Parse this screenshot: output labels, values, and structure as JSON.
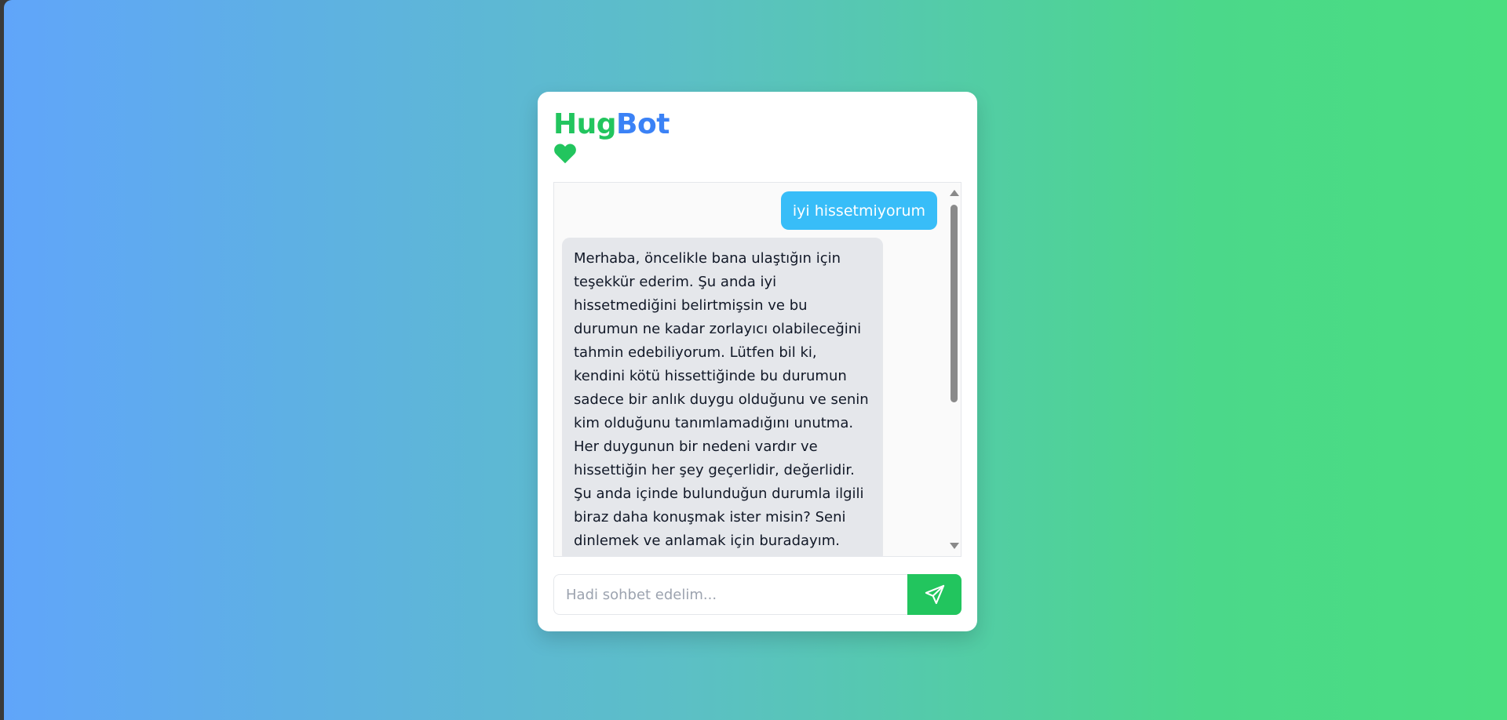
{
  "app": {
    "logo_part1": "Hug",
    "logo_part2": "Bot",
    "brand_colors": {
      "hug": "#22c55e",
      "bot": "#3b82f6"
    },
    "heart_icon": "heart-icon"
  },
  "chat": {
    "messages": [
      {
        "role": "user",
        "text": "iyi hissetmiyorum"
      },
      {
        "role": "bot",
        "text": "Merhaba, öncelikle bana ulaştığın için teşekkür ederim. Şu anda iyi hissetmediğini belirtmişsin ve bu durumun ne kadar zorlayıcı olabileceğini tahmin edebiliyorum. Lütfen bil ki, kendini kötü hissettiğinde bu durumun sadece bir anlık duygu olduğunu ve senin kim olduğunu tanımlamadığını unutma. Her duygunun bir nedeni vardır ve hissettiğin her şey geçerlidir, değerlidir. Şu anda içinde bulunduğun durumla ilgili biraz daha konuşmak ister misin? Seni dinlemek ve anlamak için buradayım."
      }
    ]
  },
  "composer": {
    "placeholder": "Hadi sohbet edelim...",
    "value": "",
    "send_icon": "send-icon"
  }
}
